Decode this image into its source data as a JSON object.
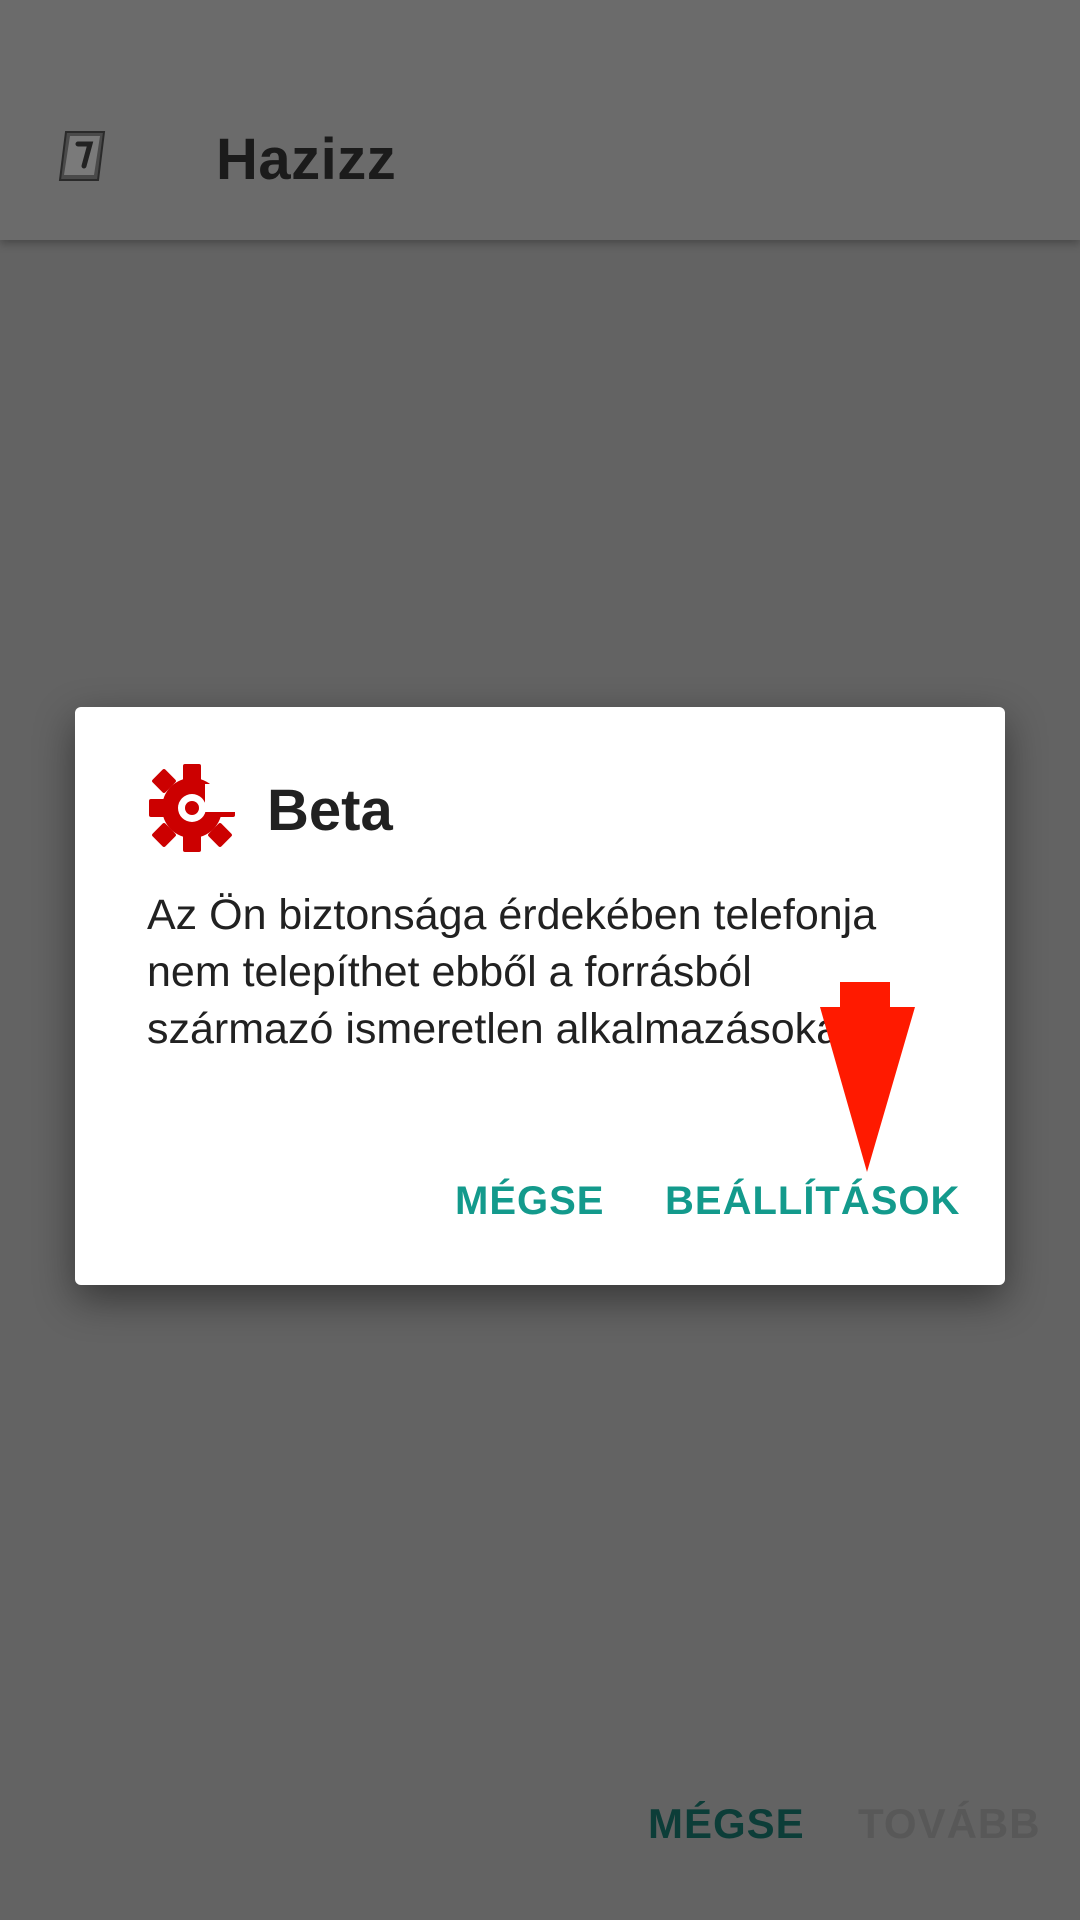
{
  "appbar": {
    "title": "Hazizz",
    "icon": "app-book-icon"
  },
  "dialog": {
    "icon": "gear-icon",
    "icon_color": "#cc0000",
    "title": "Beta",
    "message": "Az Ön biztonsága érdekében telefonja nem telepíthet ebből a forrásból származó ismeretlen alkalmazásokat.",
    "buttons": {
      "cancel": "MÉGSE",
      "settings": "BEÁLLÍTÁSOK"
    },
    "button_color": "#139a8c"
  },
  "bottom_bar": {
    "cancel": "MÉGSE",
    "next": "TOVÁBB"
  },
  "annotation": {
    "arrow": "arrow-down-icon",
    "color": "#ff1a00"
  }
}
